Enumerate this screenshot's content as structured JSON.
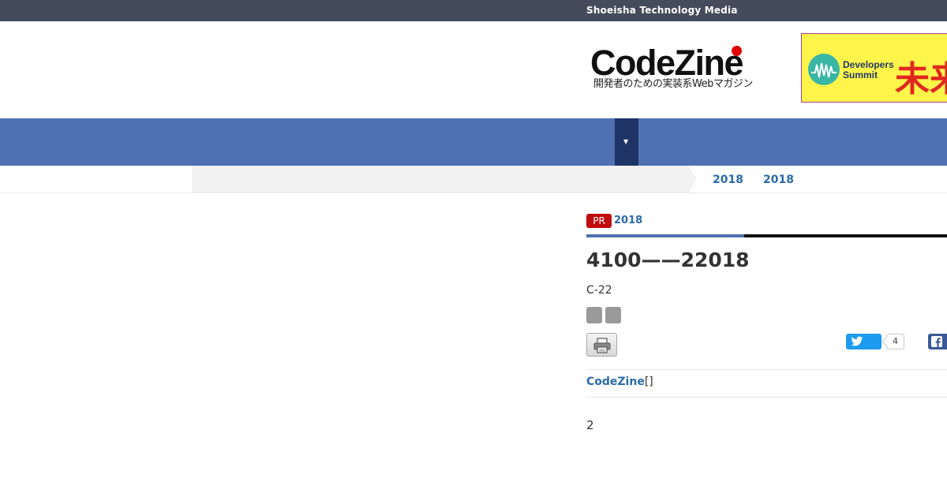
{
  "topbar": {
    "title": "Shoeisha Technology Media"
  },
  "header": {
    "logo_text": "CodeZine",
    "logo_tagline": "開発者のための実装系Webマガジン",
    "banner": {
      "line1": "Developers",
      "line2": "Summit",
      "big_text": "未来"
    }
  },
  "nav": {
    "dropdown_icon": "caret-down-icon"
  },
  "breadcrumb": {
    "items": [
      "2018",
      "2018"
    ]
  },
  "article": {
    "pr_badge": "PR",
    "category": "2018",
    "title": "4100——22018",
    "subtitle": "C-22",
    "tags": [
      "",
      ""
    ],
    "share": {
      "tweet_count": "4"
    },
    "lead_link": "CodeZine",
    "lead_suffix": "[]",
    "body": "2"
  },
  "colors": {
    "topbar": "#444b5a",
    "nav": "#5071b1",
    "nav_active": "#1e3366",
    "link": "#2a6aa8",
    "pr_badge": "#c00d0d",
    "twitter": "#1d9bf0",
    "facebook": "#3b5998"
  }
}
